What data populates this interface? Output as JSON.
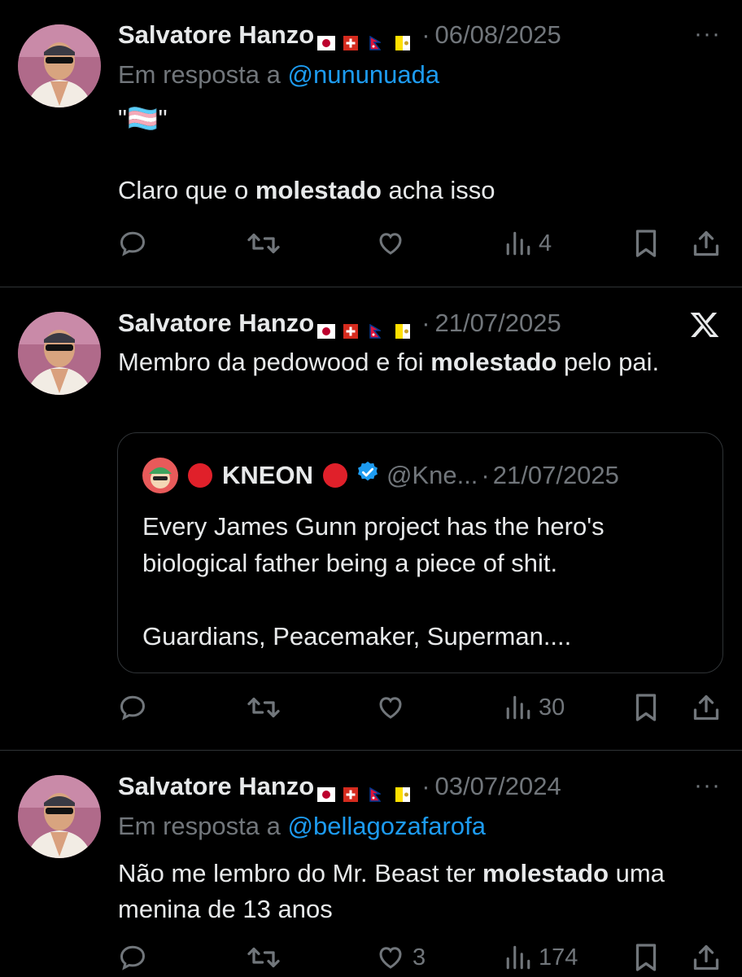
{
  "tweets": [
    {
      "name": "Salvatore Hanzo",
      "date": "06/08/2025",
      "reply_prefix": "Em resposta a",
      "reply_to": "@nununuada",
      "body_line1": "\"🏳️‍⚧️\"",
      "body_pre": "Claro que o ",
      "body_bold": "molestado",
      "body_post": " acha isso",
      "views": "4",
      "more_icon": "more-icon"
    },
    {
      "name": "Salvatore Hanzo",
      "date": "21/07/2025",
      "body_pre": "Membro da pedowood e foi ",
      "body_bold": "molestado",
      "body_post": " pelo pai.",
      "quote": {
        "name": "KNEON",
        "handle": "@Kne...",
        "date": "21/07/2025",
        "text1": "Every James Gunn project has the hero's biological father being a piece of shit.",
        "text2": "Guardians, Peacemaker, Superman...."
      },
      "views": "30"
    },
    {
      "name": "Salvatore Hanzo",
      "date": "03/07/2024",
      "reply_prefix": "Em resposta a",
      "reply_to": "@bellagozafarofa",
      "body_pre": "Não me lembro do Mr. Beast ter ",
      "body_bold": "molestado",
      "body_post": " uma menina de 13 anos",
      "likes": "3",
      "views": "174"
    }
  ],
  "colors": {
    "background": "#000000",
    "text": "#e7e9ea",
    "secondary": "#71767b",
    "link": "#1d9bf0",
    "border": "#2f3336"
  }
}
